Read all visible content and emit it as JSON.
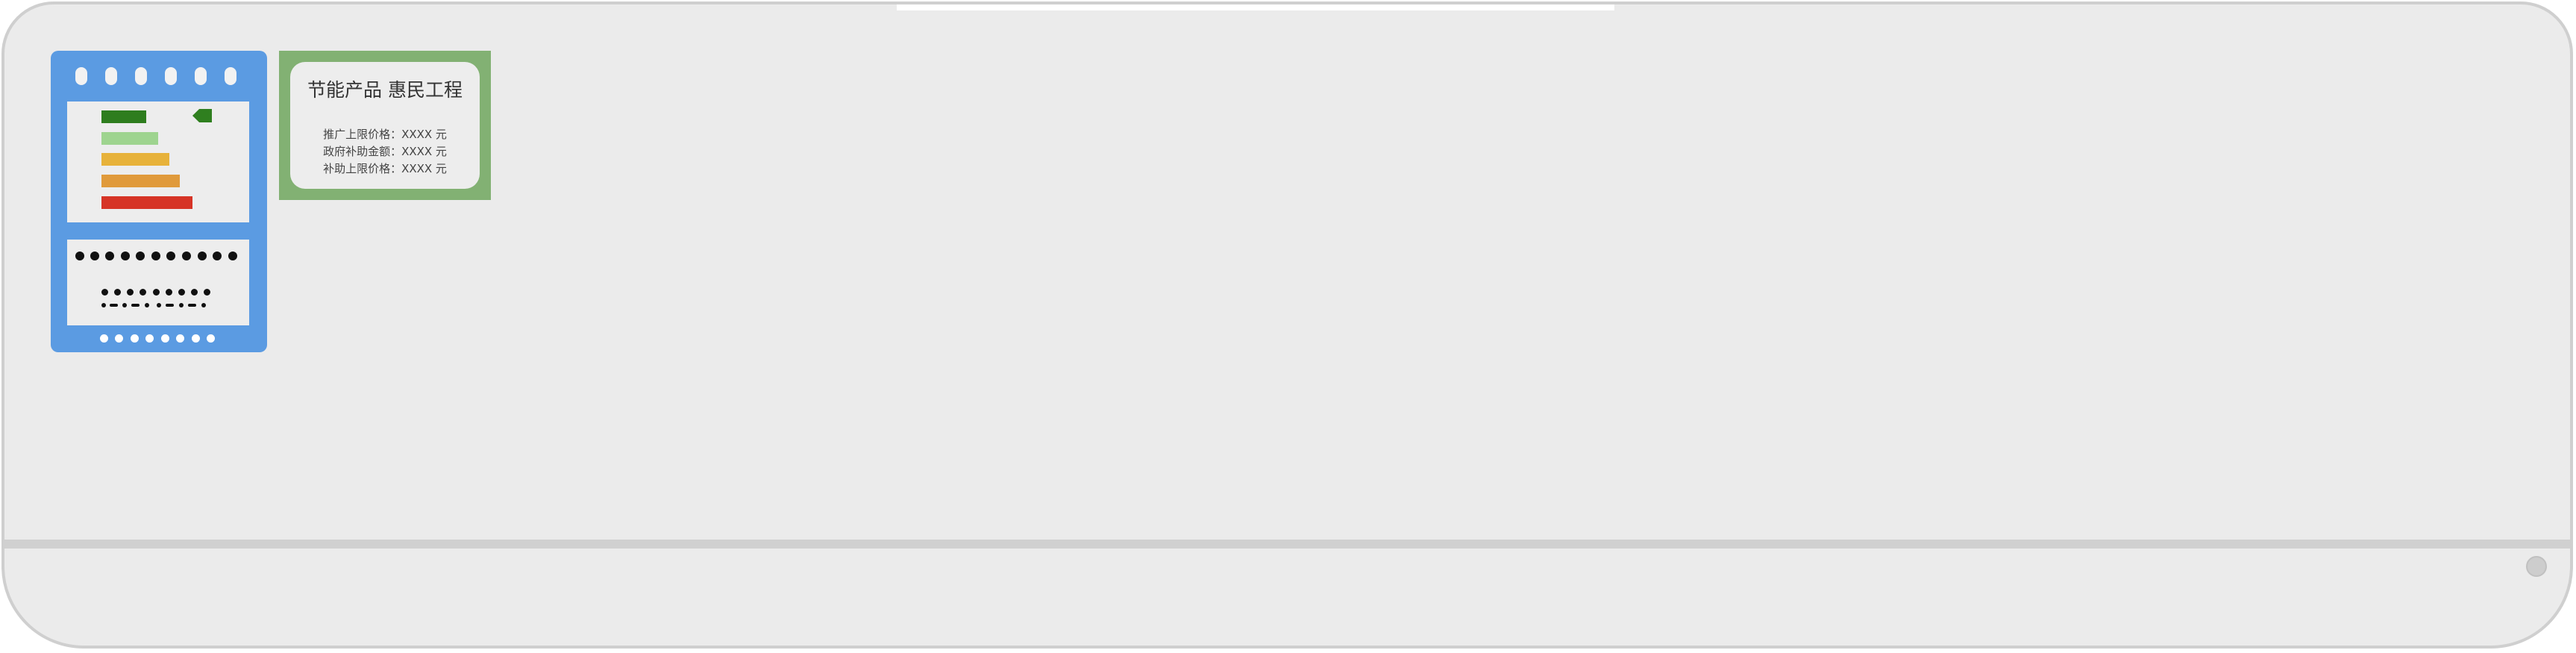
{
  "energy_label": {
    "bar_colors": [
      "#2e7d1e",
      "#9ed48f",
      "#e7b23a",
      "#e09a3b",
      "#d63426"
    ],
    "arrow_color": "#2f7f1f",
    "frame_color": "#5b9be2"
  },
  "subsidy_label": {
    "title": "节能产品 惠民工程",
    "lines": [
      "推广上限价格：XXXX 元",
      "政府补助金额：XXXX 元",
      "补助上限价格：XXXX 元"
    ],
    "frame_color": "#82b173"
  },
  "unit": {
    "body_color": "#ebebeb",
    "indicator": "status-light-icon"
  }
}
